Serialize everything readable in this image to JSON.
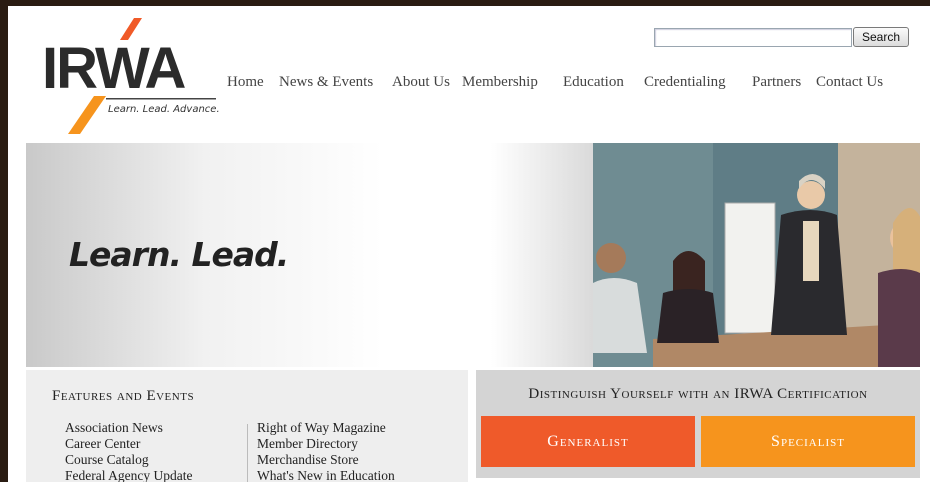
{
  "logo": {
    "text": "IRWA",
    "tagline": "Learn. Lead. Advance."
  },
  "search": {
    "placeholder": "",
    "button_label": "Search"
  },
  "nav": [
    "Home",
    "News & Events",
    "About Us",
    "Membership",
    "Education",
    "Credentialing",
    "Partners",
    "Contact Us"
  ],
  "hero": {
    "tagline": "Learn. Lead."
  },
  "features": {
    "title": "Features and Events",
    "left_links": [
      "Association News",
      "Career Center",
      "Course Catalog",
      "Federal Agency Update"
    ],
    "right_links": [
      "Right of Way Magazine",
      "Member Directory",
      "Merchandise Store",
      "What's New in Education"
    ]
  },
  "certification": {
    "title": "Distinguish Yourself with an IRWA Certification",
    "buttons": [
      "Generalist",
      "Specialist"
    ]
  },
  "colors": {
    "orange_dark": "#ef5a2a",
    "orange_light": "#f6941d",
    "frame": "#2a1c12"
  }
}
